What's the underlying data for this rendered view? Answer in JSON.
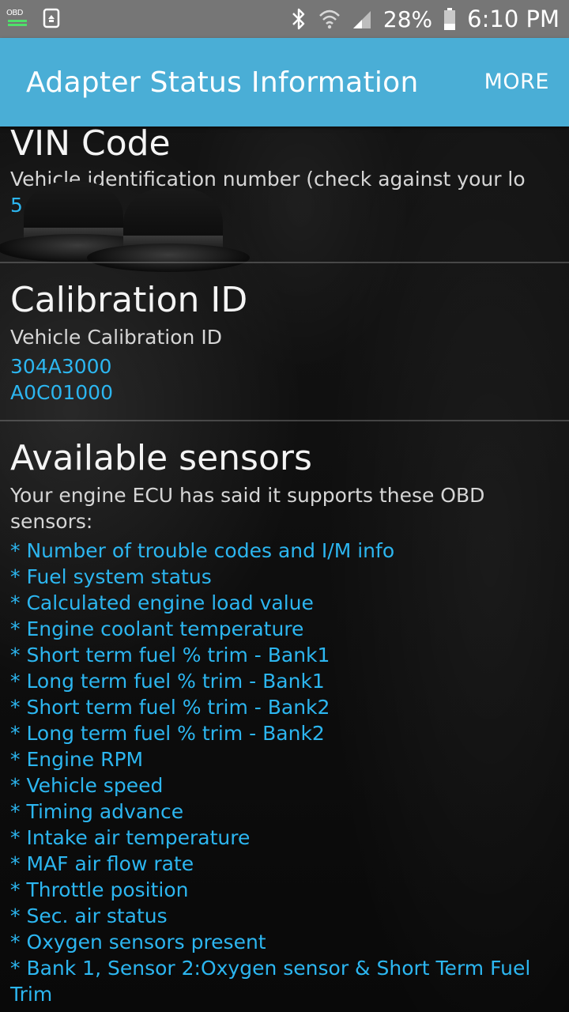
{
  "status_bar": {
    "obd_label": "OBD",
    "battery_percent": "28%",
    "time": "6:10 PM"
  },
  "app_bar": {
    "title": "Adapter Status Information",
    "more_label": "MORE"
  },
  "vin": {
    "title": "VIN Code",
    "description": "Vehicle identification number (check against your lo",
    "value": "5"
  },
  "calibration": {
    "title": "Calibration ID",
    "description": "Vehicle Calibration ID",
    "values": [
      "304A3000",
      "A0C01000"
    ]
  },
  "sensors": {
    "title": "Available sensors",
    "description": "Your engine ECU has said it supports these OBD sensors:",
    "items": [
      "* Number of trouble codes and I/M info",
      "* Fuel system status",
      "* Calculated engine load value",
      "* Engine coolant temperature",
      "* Short term fuel % trim - Bank1",
      "* Long term fuel % trim - Bank1",
      "* Short term fuel % trim - Bank2",
      "* Long term fuel % trim - Bank2",
      "* Engine RPM",
      "* Vehicle speed",
      "* Timing advance",
      "* Intake air temperature",
      "* MAF air flow rate",
      "* Throttle position",
      "* Sec. air status",
      "* Oxygen sensors present",
      "* Bank 1, Sensor 2:Oxygen sensor & Short Term Fuel Trim"
    ]
  }
}
